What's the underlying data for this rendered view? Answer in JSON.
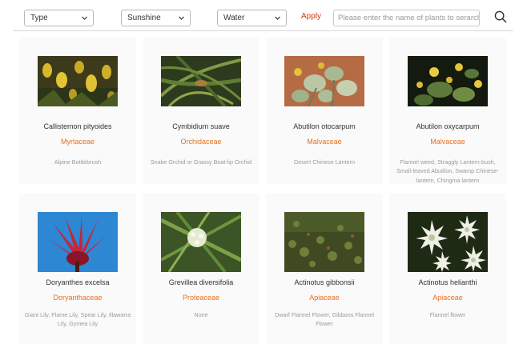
{
  "filters": {
    "type": {
      "value": "Type"
    },
    "sunshine": {
      "value": "Sunshine"
    },
    "water": {
      "value": "Water"
    },
    "apply_label": "Apply",
    "search_placeholder": "Please enter the name of plants to serarch"
  },
  "plants": [
    {
      "name": "Callistemon pityoides",
      "family": "Myrtaceae",
      "common": "Alpine Bottlebrush",
      "photo": "yellow-bottlebrush-photo"
    },
    {
      "name": "Cymbidium suave",
      "family": "Orchidaceae",
      "common": "Snake Orchid or Grassy Boat-lip Orchid",
      "photo": "green-orchid-leaves-photo"
    },
    {
      "name": "Abutilon otocarpum",
      "family": "Malvaceae",
      "common": "Desert Chinese Lantern",
      "photo": "pale-leaf-yellow-flower-photo"
    },
    {
      "name": "Abutilon oxycarpum",
      "family": "Malvaceae",
      "common": "Flannel weed, Straggly Lantern-bush, Small-leaved Abutilon, Swamp Chinese-lantern, Chingma lantern",
      "photo": "yellow-flowers-dark-photo"
    },
    {
      "name": "Doryanthes excelsa",
      "family": "Doryanthaceae",
      "common": "Giant Lily, Flame Lily, Spear Lily, Illawarra Lily, Gymea Lily",
      "photo": "red-flower-blue-sky-photo"
    },
    {
      "name": "Grevillea diversifolia",
      "family": "Proteaceae",
      "common": "None",
      "photo": "white-flower-cluster-photo"
    },
    {
      "name": "Actinotus gibbonsii",
      "family": "Apiaceae",
      "common": "Dwarf Flannel Flower, Gibbons Flannel Flower",
      "photo": "ground-cover-photo"
    },
    {
      "name": "Actinotus helianthi",
      "family": "Apiaceae",
      "common": "Flannel flower",
      "photo": "white-flannel-flowers-photo"
    }
  ],
  "colors": {
    "accent": "#e8711d",
    "apply": "#d9360b",
    "card_bg": "#fafafa"
  }
}
